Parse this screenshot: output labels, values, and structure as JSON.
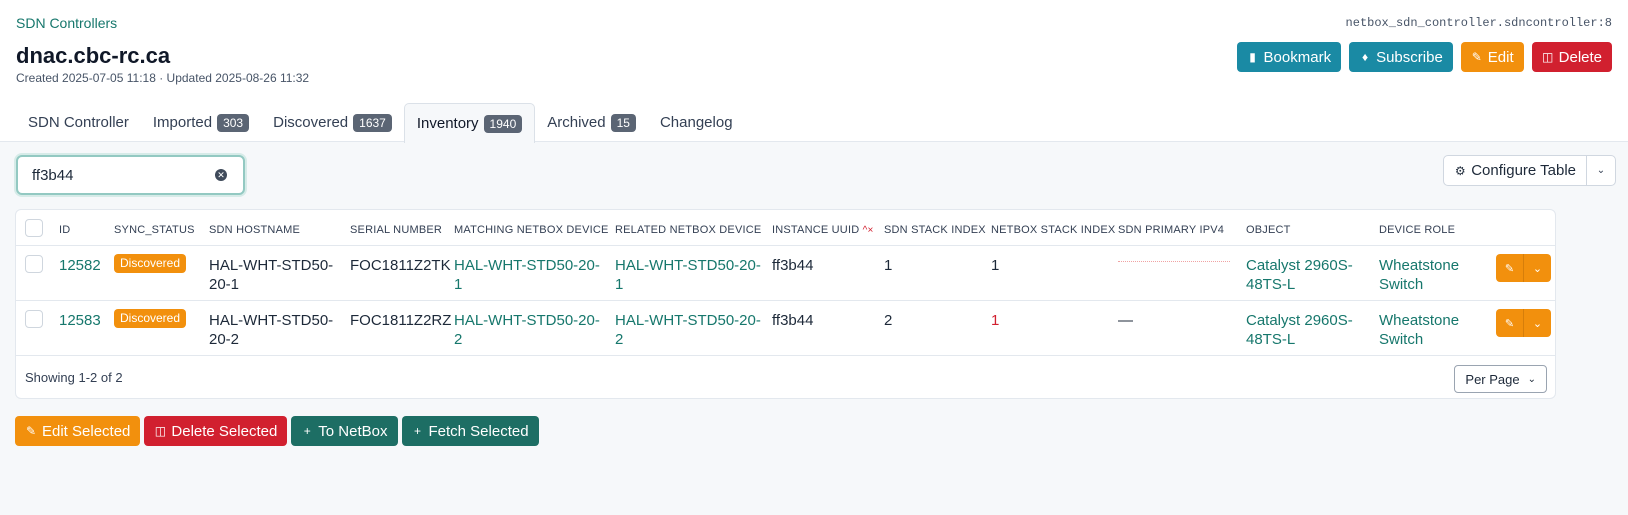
{
  "breadcrumb": "SDN Controllers",
  "object_ref": "netbox_sdn_controller.sdncontroller:8",
  "title": "dnac.cbc-rc.ca",
  "meta": "Created 2025-07-05 11:18 · Updated 2025-08-26 11:32",
  "actions": {
    "bookmark": "Bookmark",
    "subscribe": "Subscribe",
    "edit": "Edit",
    "delete": "Delete"
  },
  "tabs": [
    {
      "label": "SDN Controller",
      "count": ""
    },
    {
      "label": "Imported",
      "count": "303"
    },
    {
      "label": "Discovered",
      "count": "1637"
    },
    {
      "label": "Inventory",
      "count": "1940"
    },
    {
      "label": "Archived",
      "count": "15"
    },
    {
      "label": "Changelog",
      "count": ""
    }
  ],
  "search": {
    "value": "ff3b44"
  },
  "configure_table": "Configure Table",
  "table": {
    "headers": {
      "id": "ID",
      "sync_status": "SYNC_STATUS",
      "sdn_hostname": "SDN HOSTNAME",
      "serial_number": "SERIAL NUMBER",
      "matching_device": "MATCHING NETBOX DEVICE",
      "related_device": "RELATED NETBOX DEVICE",
      "instance_uuid": "INSTANCE UUID",
      "sort_indicator": "^×",
      "sdn_stack_index": "SDN STACK INDEX",
      "netbox_stack_index": "NETBOX STACK INDEX",
      "sdn_primary_ipv4": "SDN PRIMARY IPV4",
      "object": "OBJECT",
      "device_role": "DEVICE ROLE"
    },
    "rows": [
      {
        "id": "12582",
        "status": "Discovered",
        "hostname": [
          "HAL-WHT-STD50-",
          "20-1"
        ],
        "serial": "FOC1811Z2TK",
        "matching": [
          "HAL-WHT-STD50-20-",
          "1"
        ],
        "related": [
          "HAL-WHT-STD50-20-",
          "1"
        ],
        "uuid": "ff3b44",
        "sdn_stack": "1",
        "netbox_stack": "1",
        "ipv4": "",
        "object": [
          "Catalyst 2960S-",
          "48TS-L"
        ],
        "role": [
          "Wheatstone",
          "Switch"
        ]
      },
      {
        "id": "12583",
        "status": "Discovered",
        "hostname": [
          "HAL-WHT-STD50-",
          "20-2"
        ],
        "serial": "FOC1811Z2RZ",
        "matching": [
          "HAL-WHT-STD50-20-",
          "2"
        ],
        "related": [
          "HAL-WHT-STD50-20-",
          "2"
        ],
        "uuid": "ff3b44",
        "sdn_stack": "2",
        "netbox_stack": "1",
        "ipv4": "—",
        "object": [
          "Catalyst 2960S-",
          "48TS-L"
        ],
        "role": [
          "Wheatstone",
          "Switch"
        ]
      }
    ],
    "showing": "Showing 1-2 of 2",
    "per_page": "Per Page"
  },
  "bulk_actions": {
    "edit_selected": "Edit Selected",
    "delete_selected": "Delete Selected",
    "to_netbox": "To NetBox",
    "fetch_selected": "Fetch Selected"
  },
  "colors": {
    "accent": "#16776c",
    "warning": "#f2900d",
    "danger": "#d1202f",
    "info": "#1a8aa4"
  }
}
